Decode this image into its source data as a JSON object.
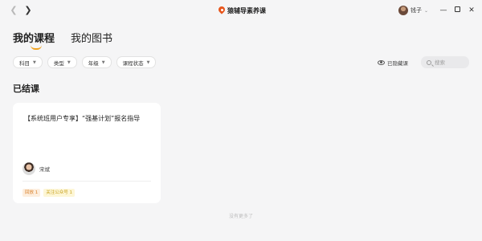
{
  "app": {
    "title": "猿辅导素养课"
  },
  "user": {
    "name": "钱子"
  },
  "tabs": [
    {
      "label": "我的课程",
      "active": true
    },
    {
      "label": "我的图书",
      "active": false
    }
  ],
  "filters": [
    {
      "label": "科目"
    },
    {
      "label": "类型"
    },
    {
      "label": "年级"
    },
    {
      "label": "课程状态"
    }
  ],
  "hidden_toggle": {
    "label": "已隐藏课"
  },
  "search": {
    "placeholder": "搜索"
  },
  "section": {
    "title": "已结课"
  },
  "card": {
    "title": "【系统班用户专享】“强基计划”报名指导",
    "teacher": "宋斌",
    "tags": [
      {
        "label": "回放 1"
      },
      {
        "label": "关注公众号 1"
      }
    ]
  },
  "footer": {
    "no_more": "没有更多了"
  },
  "colors": {
    "accent": "#f0a320",
    "background": "#f5f5f6",
    "brand_pin": "#e8561d"
  }
}
